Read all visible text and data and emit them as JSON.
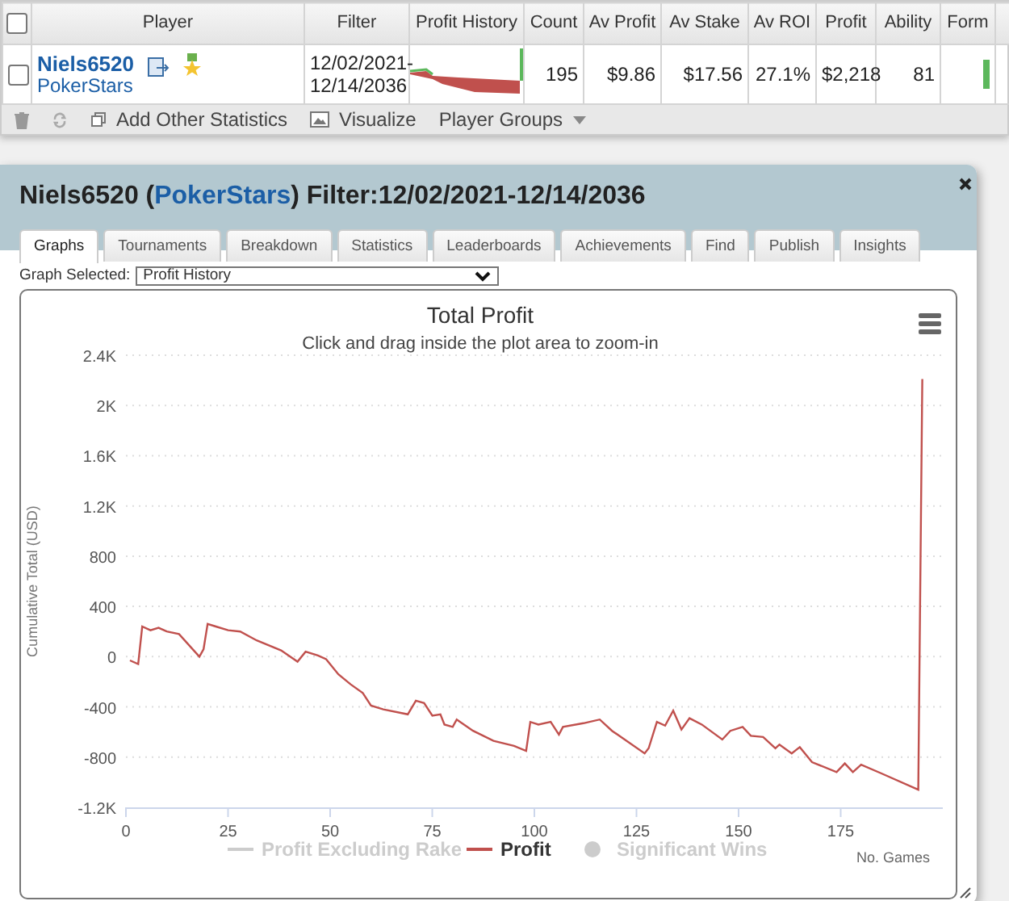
{
  "table": {
    "header_checked": false,
    "columns": [
      "Player",
      "Filter",
      "Profit History",
      "Count",
      "Av Profit",
      "Av Stake",
      "Av ROI",
      "Profit",
      "Ability",
      "Form"
    ],
    "rows": [
      {
        "checked": false,
        "player": "Niels6520",
        "site": "PokerStars",
        "filter": [
          "12/02/2021-",
          "12/14/2036"
        ],
        "count": "195",
        "av_profit": "$9.86",
        "av_stake": "$17.56",
        "av_roi": "27.1%",
        "profit": "$2,218",
        "ability": "81"
      }
    ]
  },
  "toolbar": [
    "Add Other Statistics",
    "Visualize",
    "Player Groups"
  ],
  "dialog": {
    "title_before": "Niels6520 (",
    "title_link": "PokerStars",
    "title_after": ") Filter:12/02/2021-12/14/2036",
    "tabs": [
      {
        "label": "Graphs",
        "selected": true
      },
      {
        "label": "Tournaments",
        "selected": false
      },
      {
        "label": "Breakdown",
        "selected": false
      },
      {
        "label": "Statistics",
        "selected": false
      },
      {
        "label": "Leaderboards",
        "selected": false
      },
      {
        "label": "Achievements",
        "selected": false
      },
      {
        "label": "Find",
        "selected": false
      },
      {
        "label": "Publish",
        "selected": false
      },
      {
        "label": "Insights",
        "selected": false
      }
    ],
    "graph_label": "Graph Selected:",
    "graph_value": "Profit History",
    "legend": [
      {
        "label": "Profit Excluding Rake",
        "kind": "line",
        "visible": false
      },
      {
        "kind": "series",
        "visible": true
      },
      {
        "label": "Significant Wins",
        "kind": "dot",
        "visible": false
      }
    ],
    "chart_data": {
      "type": "line",
      "title": "Total Profit",
      "subtitle": "Click and drag inside the plot area to zoom-in",
      "xlabel": "No. Games",
      "ylabel": "Cumulative Total (USD)",
      "grid": true,
      "xlim": [
        0,
        200
      ],
      "ylim": [
        -1200,
        2400
      ],
      "xticks": [
        0,
        25,
        50,
        75,
        100,
        125,
        150,
        175
      ],
      "yticks": [
        {
          "value": -1200,
          "label": "-1.2K"
        },
        {
          "value": -800,
          "label": "-800"
        },
        {
          "value": -400,
          "label": "-400"
        },
        {
          "value": 0,
          "label": "0"
        },
        {
          "value": 400,
          "label": "400"
        },
        {
          "value": 800,
          "label": "800"
        },
        {
          "value": 1200,
          "label": "1.2K"
        },
        {
          "value": 1600,
          "label": "1.6K"
        },
        {
          "value": 2000,
          "label": "2K"
        },
        {
          "value": 2400,
          "label": "2.4K"
        }
      ],
      "x": [
        1,
        3,
        4,
        6,
        8,
        10,
        13,
        18,
        19,
        20,
        22,
        25,
        28,
        32,
        38,
        42,
        44,
        47,
        49,
        52,
        55,
        58,
        60,
        63,
        69,
        71,
        73,
        75,
        77,
        78,
        80,
        81,
        85,
        90,
        95,
        98,
        99,
        101,
        104,
        106,
        107,
        112,
        116,
        119,
        127,
        128,
        130,
        132,
        134,
        136,
        138,
        141,
        146,
        148,
        151,
        153,
        156,
        159,
        160,
        163,
        165,
        168,
        174,
        176,
        178,
        180,
        185,
        194,
        195
      ],
      "series": [
        {
          "name": "Profit",
          "color": "#c0504d",
          "values": [
            -30,
            -60,
            240,
            210,
            230,
            200,
            180,
            0,
            60,
            260,
            240,
            210,
            200,
            130,
            50,
            -40,
            40,
            10,
            -20,
            -140,
            -220,
            -290,
            -390,
            -420,
            -460,
            -350,
            -370,
            -470,
            -460,
            -540,
            -560,
            -500,
            -590,
            -670,
            -710,
            -750,
            -520,
            -540,
            -520,
            -620,
            -560,
            -530,
            -500,
            -590,
            -770,
            -730,
            -520,
            -550,
            -430,
            -580,
            -490,
            -540,
            -660,
            -590,
            -560,
            -630,
            -640,
            -730,
            -700,
            -770,
            -720,
            -840,
            -920,
            -850,
            -920,
            -860,
            -930,
            -1060,
            2210
          ]
        }
      ]
    }
  }
}
